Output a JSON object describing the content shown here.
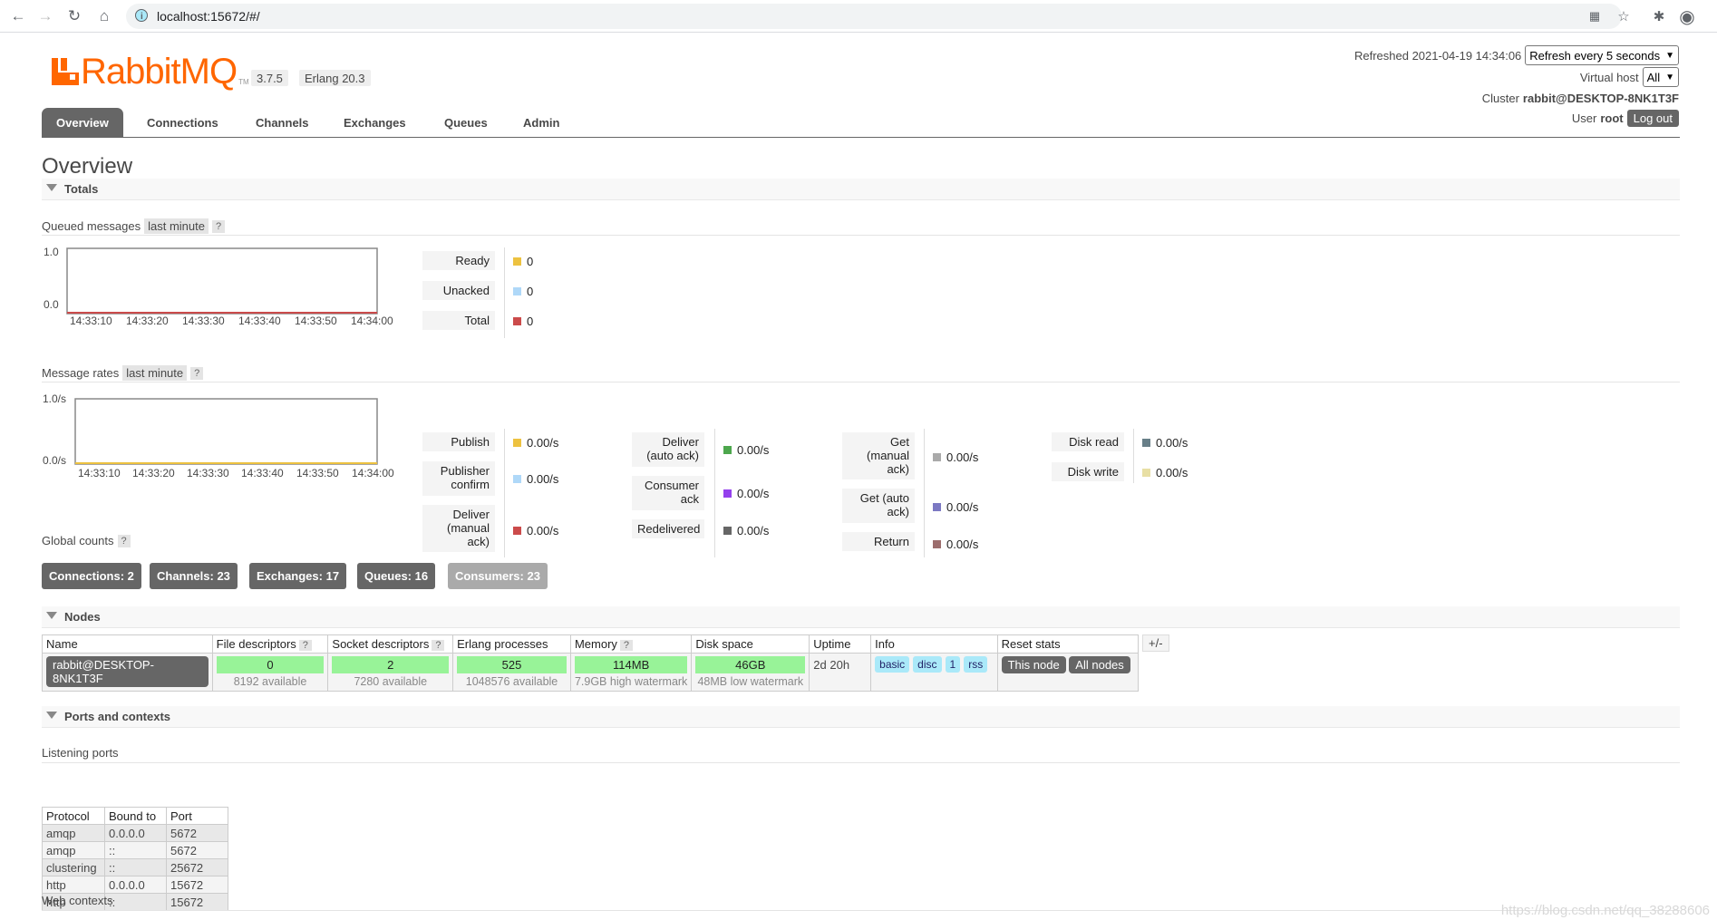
{
  "browser": {
    "url": "localhost:15672/#/"
  },
  "header": {
    "logo_text": "RabbitMQ",
    "logo_tm": "TM",
    "version": "3.7.5",
    "erlang": "Erlang 20.3",
    "refreshed_label": "Refreshed 2021-04-19 14:34:06",
    "refresh_select": "Refresh every 5 seconds",
    "vhost_label": "Virtual host",
    "vhost_select": "All",
    "cluster_label": "Cluster",
    "cluster_name": "rabbit@DESKTOP-8NK1T3F",
    "user_label": "User",
    "user_name": "root",
    "logout_label": "Log out"
  },
  "tabs": [
    "Overview",
    "Connections",
    "Channels",
    "Exchanges",
    "Queues",
    "Admin"
  ],
  "page_title": "Overview",
  "totals": {
    "section_title": "Totals",
    "queued": {
      "label": "Queued messages",
      "range": "last minute",
      "help": "?",
      "y_top": "1.0",
      "y_bottom": "0.0",
      "x_ticks": [
        "14:33:10",
        "14:33:20",
        "14:33:30",
        "14:33:40",
        "14:33:50",
        "14:34:00"
      ],
      "legend": [
        {
          "label": "Ready",
          "value": "0",
          "color": "#edc240"
        },
        {
          "label": "Unacked",
          "value": "0",
          "color": "#afd8f8"
        },
        {
          "label": "Total",
          "value": "0",
          "color": "#cb4b4b"
        }
      ]
    },
    "rates": {
      "label": "Message rates",
      "range": "last minute",
      "help": "?",
      "y_top": "1.0/s",
      "y_bottom": "0.0/s",
      "x_ticks": [
        "14:33:10",
        "14:33:20",
        "14:33:30",
        "14:33:40",
        "14:33:50",
        "14:34:00"
      ],
      "col1": [
        {
          "label": "Publish",
          "value": "0.00/s",
          "color": "#edc240"
        },
        {
          "label": "Publisher confirm",
          "value": "0.00/s",
          "color": "#afd8f8"
        },
        {
          "label": "Deliver (manual ack)",
          "value": "0.00/s",
          "color": "#cb4b4b"
        }
      ],
      "col2": [
        {
          "label": "Deliver (auto ack)",
          "value": "0.00/s",
          "color": "#4da74d"
        },
        {
          "label": "Consumer ack",
          "value": "0.00/s",
          "color": "#9440ed"
        },
        {
          "label": "Redelivered",
          "value": "0.00/s",
          "color": "#666666"
        }
      ],
      "col3": [
        {
          "label": "Get (manual ack)",
          "value": "0.00/s",
          "color": "#aaaaaa"
        },
        {
          "label": "Get (auto ack)",
          "value": "0.00/s",
          "color": "#7c79c3"
        },
        {
          "label": "Return",
          "value": "0.00/s",
          "color": "#9c6d6d"
        }
      ],
      "col4": [
        {
          "label": "Disk read",
          "value": "0.00/s",
          "color": "#687f88"
        },
        {
          "label": "Disk write",
          "value": "0.00/s",
          "color": "#e8dfa4"
        }
      ]
    },
    "global": {
      "label": "Global counts",
      "help": "?",
      "buttons": [
        "Connections: 2",
        "Channels: 23",
        "Exchanges: 17",
        "Queues: 16",
        "Consumers: 23"
      ]
    }
  },
  "nodes": {
    "section_title": "Nodes",
    "toggle": "+/-",
    "headers": [
      "Name",
      "File descriptors",
      "Socket descriptors",
      "Erlang processes",
      "Memory",
      "Disk space",
      "Uptime",
      "Info",
      "Reset stats"
    ],
    "help": "?",
    "row": {
      "name": "rabbit@DESKTOP-8NK1T3F",
      "fd": "0",
      "fd_avail": "8192 available",
      "sockets": "2",
      "sockets_avail": "7280 available",
      "procs": "525",
      "procs_avail": "1048576 available",
      "memory": "114MB",
      "memory_wm": "7.9GB high watermark",
      "disk": "46GB",
      "disk_wm": "48MB low watermark",
      "uptime": "2d 20h",
      "info": [
        "basic",
        "disc",
        "1",
        "rss"
      ],
      "reset_this": "This node",
      "reset_all": "All nodes"
    }
  },
  "ports": {
    "section_title": "Ports and contexts",
    "listening_label": "Listening ports",
    "headers": [
      "Protocol",
      "Bound to",
      "Port"
    ],
    "rows": [
      [
        "amqp",
        "0.0.0.0",
        "5672"
      ],
      [
        "amqp",
        "::",
        "5672"
      ],
      [
        "clustering",
        "::",
        "25672"
      ],
      [
        "http",
        "0.0.0.0",
        "15672"
      ],
      [
        "http",
        "::",
        "15672"
      ]
    ],
    "web_contexts_label": "Web contexts"
  },
  "watermark": "https://blog.csdn.net/qq_38288606"
}
